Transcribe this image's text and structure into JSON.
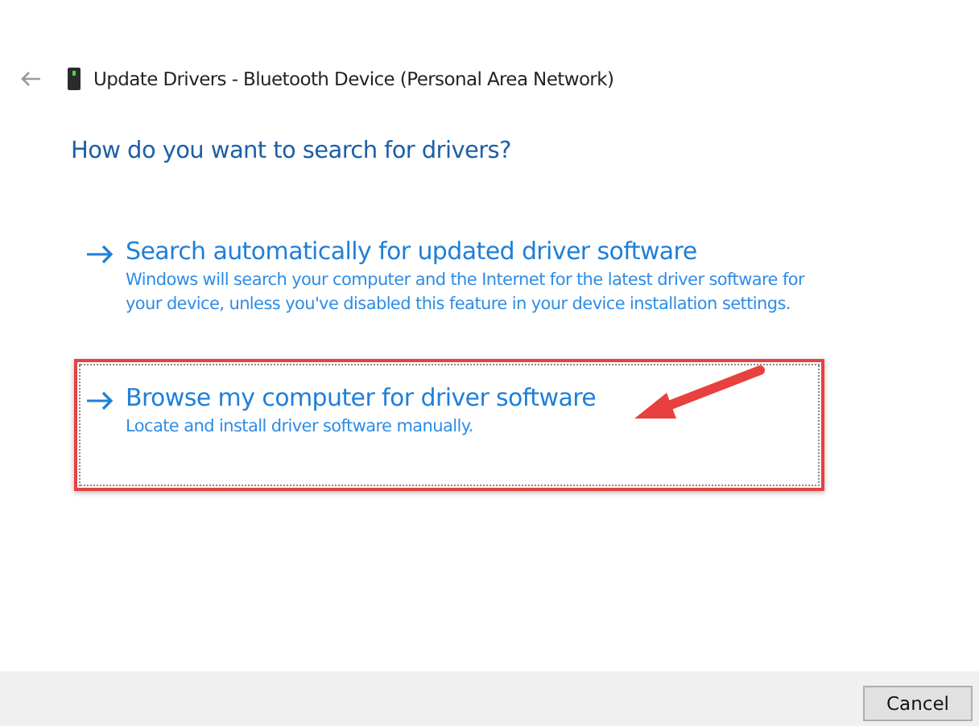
{
  "window": {
    "title": "Update Drivers - Bluetooth Device (Personal Area Network)"
  },
  "heading": "How do you want to search for drivers?",
  "options": [
    {
      "title": "Search automatically for updated driver software",
      "description": "Windows will search your computer and the Internet for the latest driver software for your device, unless you've disabled this feature in your device installation settings.",
      "highlighted": false
    },
    {
      "title": "Browse my computer for driver software",
      "description": "Locate and install driver software manually.",
      "highlighted": true
    }
  ],
  "buttons": [
    "Cancel"
  ]
}
